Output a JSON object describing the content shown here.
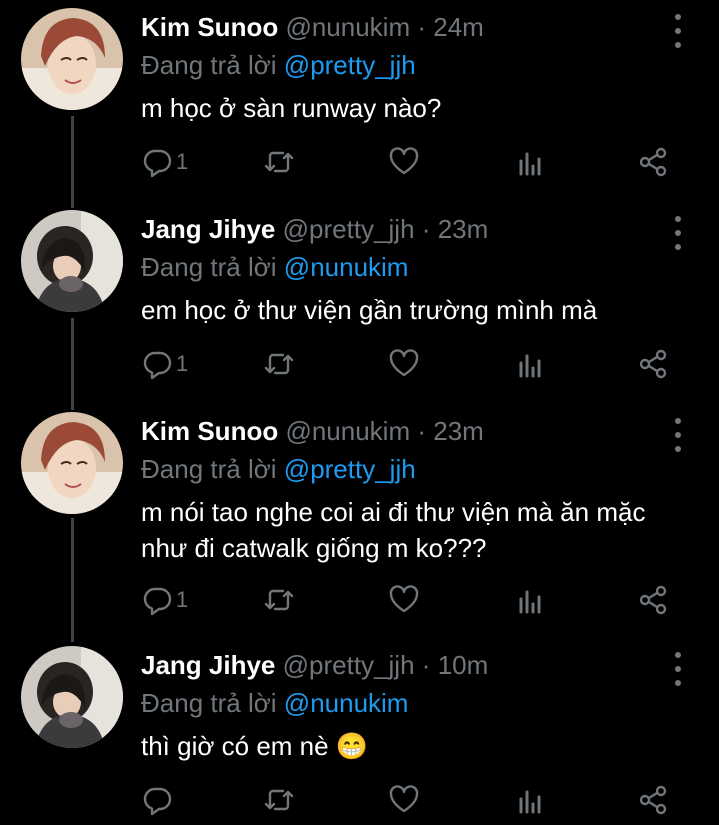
{
  "colors": {
    "background": "#000000",
    "text": "#ffffff",
    "muted": "#71767b",
    "link": "#1d9bf0",
    "thread": "#3d4348"
  },
  "reply_prefix": "Đang trả lời",
  "tweets": [
    {
      "name": "Kim Sunoo",
      "handle": "@nunukim",
      "time": "24m",
      "reply_to": "@pretty_jjh",
      "lines": [
        "m học ở sàn runway nào?"
      ],
      "reply_count": "1",
      "avatar": "boy-avatar"
    },
    {
      "name": "Jang Jihye",
      "handle": "@pretty_jjh",
      "time": "23m",
      "reply_to": "@nunukim",
      "lines": [
        "em học ở thư viện gần trường mình mà"
      ],
      "reply_count": "1",
      "avatar": "girl-avatar"
    },
    {
      "name": "Kim Sunoo",
      "handle": "@nunukim",
      "time": "23m",
      "reply_to": "@pretty_jjh",
      "lines": [
        "m nói tao nghe coi ai đi thư viện mà ăn mặc",
        "như đi catwalk giống m ko???"
      ],
      "reply_count": "1",
      "avatar": "boy-avatar"
    },
    {
      "name": "Jang Jihye",
      "handle": "@pretty_jjh",
      "time": "10m",
      "reply_to": "@nunukim",
      "lines": [
        "thì giờ có em nè 😁"
      ],
      "reply_count": "",
      "avatar": "girl-avatar"
    }
  ]
}
